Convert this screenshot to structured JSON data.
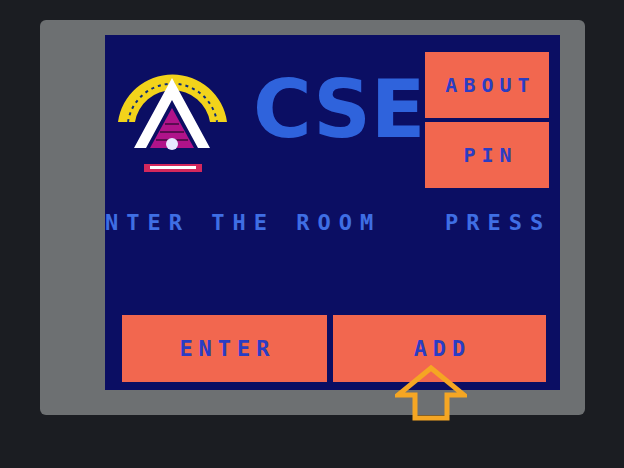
{
  "header": {
    "title": "CSE"
  },
  "side_buttons": [
    {
      "label": "ABOUT"
    },
    {
      "label": "PIN"
    }
  ],
  "marquee": {
    "text": "NTER THE ROOM   PRESS"
  },
  "action_buttons": [
    {
      "label": "ENTER",
      "highlighted": false
    },
    {
      "label": "ADD",
      "highlighted": true
    }
  ]
}
